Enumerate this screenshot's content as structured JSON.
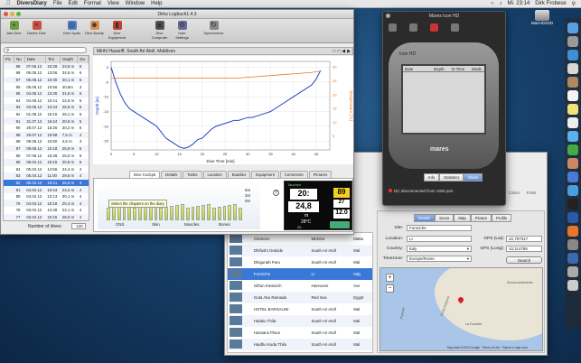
{
  "menubar": {
    "app": "DiversDiary",
    "items": [
      "File",
      "Edit",
      "Format",
      "View",
      "Window",
      "Help"
    ],
    "clock": "Mi. 23:14",
    "user": "Dirk Frobese"
  },
  "desktop": {
    "drive_label": "MacHDSSD"
  },
  "main_window": {
    "title": "Dirks Logbuch1.4.3",
    "toolbar": [
      "Add Dive",
      "Delete Dive",
      "Dive Spots",
      "Dive Buddy",
      "Dive Equipment",
      "Dive Computer",
      "User Settings",
      "Synchronize"
    ],
    "list_headers": [
      "Pic",
      "No",
      "Date",
      "Tim",
      "Depth",
      "Du"
    ],
    "rows": [
      [
        "99",
        "07.06.12",
        "10:29",
        "23,8 m",
        "6"
      ],
      [
        "98",
        "06.06.12",
        "13:06",
        "34,6 m",
        "6"
      ],
      [
        "97",
        "06.06.12",
        "10:30",
        "30,1 m",
        "6"
      ],
      [
        "96",
        "05.06.12",
        "10:56",
        "40,6m",
        "3"
      ],
      [
        "95",
        "04.06.12",
        "13:45",
        "31,6 m",
        "5"
      ],
      [
        "94",
        "04.06.12",
        "10:41",
        "22,9 m",
        "6"
      ],
      [
        "93",
        "03.06.12",
        "10:44",
        "26,5 m",
        "6"
      ],
      [
        "92",
        "01.08.12",
        "16:15",
        "29,1 m",
        "6"
      ],
      [
        "91",
        "31.07.12",
        "16:24",
        "20,6 m",
        "5"
      ],
      [
        "90",
        "29.07.12",
        "15:25",
        "30,2 m",
        "5"
      ],
      [
        "89",
        "28.07.12",
        "15:58",
        "7,5 m",
        "4"
      ],
      [
        "88",
        "09.06.12",
        "10:50",
        "4,6 m",
        "3"
      ],
      [
        "87",
        "09.06.12",
        "15:18",
        "26,8 m",
        "6"
      ],
      [
        "86",
        "07.06.12",
        "15:28",
        "26,5 m",
        "6"
      ],
      [
        "85",
        "08.04.12",
        "15:16",
        "20,8 m",
        "6"
      ],
      [
        "84",
        "05.04.12",
        "14:56",
        "24,4 m",
        "4"
      ],
      [
        "83",
        "05.04.12",
        "11:00",
        "29,8 m",
        "4"
      ],
      [
        "82",
        "05.04.12",
        "16:21",
        "25,8 m",
        "4"
      ],
      [
        "81",
        "04.04.12",
        "10:24",
        "24,2 m",
        "4"
      ],
      [
        "80",
        "04.04.12",
        "13:13",
        "30,1 m",
        "4"
      ],
      [
        "79",
        "04.04.12",
        "10:19",
        "20,4 m",
        "4"
      ],
      [
        "78",
        "03.04.12",
        "14:48",
        "24,1 m",
        "4"
      ],
      [
        "77",
        "03.04.12",
        "10:15",
        "28,0 m",
        "4"
      ],
      [
        "76",
        "02.04.12",
        "10:54",
        "23,8 m",
        "4"
      ],
      [
        "75",
        "02.04.12",
        "10:26",
        "21,9 m",
        "4"
      ],
      [
        "74",
        "31.03.12",
        "10:35",
        "24,6 m",
        "4"
      ]
    ],
    "selected_index": 17,
    "footer_label": "Number of dives:",
    "footer_count": "120"
  },
  "profile": {
    "location": "Mirihi Hausriff, South Ari Atoll, Maldives",
    "xlabel": "Dive Time [min]",
    "ylabel_left": "Depth [m]",
    "ylabel_right": "Temperature [°C]",
    "xticks": [
      "0",
      "5",
      "10",
      "15",
      "20",
      "25",
      "30",
      "35",
      "40",
      "45"
    ],
    "yticks_left": [
      "0",
      "-5",
      "-10",
      "-15",
      "-20",
      "-25"
    ],
    "yticks_right": [
      "30",
      "25",
      "20",
      "15",
      "10",
      "5"
    ]
  },
  "chart_data": {
    "type": "line",
    "xlabel": "Dive Time [min]",
    "ylabel": "Depth [m]",
    "y2label": "Temperature [°C]",
    "xlim": [
      0,
      48
    ],
    "ylim": [
      -28,
      2
    ],
    "y2lim": [
      0,
      32
    ],
    "series": [
      {
        "name": "",
        "axis": "left",
        "color": "#2242c8",
        "x": [
          0,
          1,
          2,
          3,
          4,
          5,
          6,
          7,
          8,
          9,
          10,
          11,
          12,
          13,
          14,
          15,
          16,
          17,
          18,
          19,
          20,
          21,
          22,
          23,
          24,
          25,
          26,
          27,
          28,
          29,
          30,
          31,
          32,
          33,
          34,
          35,
          36,
          37,
          38,
          39,
          40,
          41,
          42,
          43,
          44,
          45,
          46
        ],
        "y": [
          0,
          -5,
          -9,
          -12,
          -14,
          -15,
          -16,
          -17,
          -18,
          -19,
          -20,
          -22,
          -24,
          -25,
          -26,
          -27,
          -27.5,
          -27,
          -26,
          -24.5,
          -24,
          -22.5,
          -21,
          -20,
          -19.5,
          -19,
          -18.5,
          -18,
          -18,
          -17.5,
          -17,
          -17,
          -16.5,
          -16,
          -15.5,
          -15,
          -14,
          -13,
          -12,
          -11,
          -10,
          -9,
          -8,
          -7,
          -6,
          -4,
          -1
        ]
      },
      {
        "name": "",
        "axis": "right",
        "color": "#e07820",
        "x": [
          0,
          4,
          8,
          12,
          16,
          20,
          24,
          28,
          32,
          36,
          40,
          44,
          46
        ],
        "y": [
          26,
          26,
          26,
          26,
          26,
          26,
          26,
          26,
          26.5,
          27,
          27.5,
          28,
          28.5
        ]
      }
    ]
  },
  "profile_tabs": [
    "Dive Cockpit",
    "Details",
    "Tanks",
    "Location",
    "Buddies",
    "Equipment",
    "Comments",
    "Pictures"
  ],
  "chapter_labels": [
    "CNS",
    "Skin",
    "Muscles",
    "Bones"
  ],
  "chapter_tooltip": "Select the chapters on the diary",
  "depth_marks": [
    "6m",
    "3m",
    "0m"
  ],
  "computer": {
    "depth": "20:",
    "depth2": "24,8",
    "temp": "28°C",
    "time": "89",
    "val2": "27",
    "ndl": "12.0",
    "unit": "m",
    "top_label": "Tauchen",
    "pct": "25"
  },
  "mares": {
    "title": "Mares Icon HD",
    "brand": "Icon HD",
    "logo": "mares",
    "headers": [
      "Date",
      "Depth",
      "D-Time",
      "Mode"
    ],
    "tabs": [
      "Info",
      "Statistics",
      "Dives"
    ],
    "status": "DC disconnected from USB port"
  },
  "spots": {
    "tabs": [
      "Details",
      "Score",
      "Map",
      "Picture",
      "Profile"
    ],
    "toolbar": [
      "Export Spots",
      "Import Spots",
      "Colors",
      "Fonts"
    ],
    "site_label": "Site:",
    "site": "Formiche",
    "location_label": "Location:",
    "location": "LI",
    "country_label": "Country:",
    "country": "Italy",
    "tz_label": "Timezone:",
    "tz": "Europe/Rome",
    "lat_label": "GPS (Lat):",
    "lat": "42,797317",
    "long_label": "GPS (Long):",
    "long": "10,114785",
    "search": "Search",
    "map_attrib": "Map data ©2013 Google · Terms of Use · Report a map error",
    "map_places": [
      "Zecca-santaninee",
      "La Guardia",
      "Punta Falcone",
      "Pianosa"
    ],
    "list": [
      [
        "Cirenezo",
        "Meloria",
        "Malta"
      ],
      [
        "Dhifushi Outside",
        "South Ari Atoll",
        "Mal"
      ],
      [
        "Dhiguriah Faru",
        "South Ari Atoll",
        "Mal"
      ],
      [
        "Formiche",
        "LI",
        "Italy"
      ],
      [
        "Giftun Kiesteich",
        "Hannover",
        "Ger"
      ],
      [
        "Gota Abu Ramada",
        "Red Sea",
        "Egypt"
      ],
      [
        "HOTEL BARSALINI",
        "South Ari Atoll",
        "Mal"
      ],
      [
        "Halaku Thila",
        "South Ari Atoll",
        "Mal"
      ],
      [
        "Hassans Place",
        "South Ari Atoll",
        "Mal"
      ],
      [
        "Haidhu Kuda Thila",
        "South Ari Atoll",
        "Mal"
      ]
    ],
    "selected_index": 3
  }
}
